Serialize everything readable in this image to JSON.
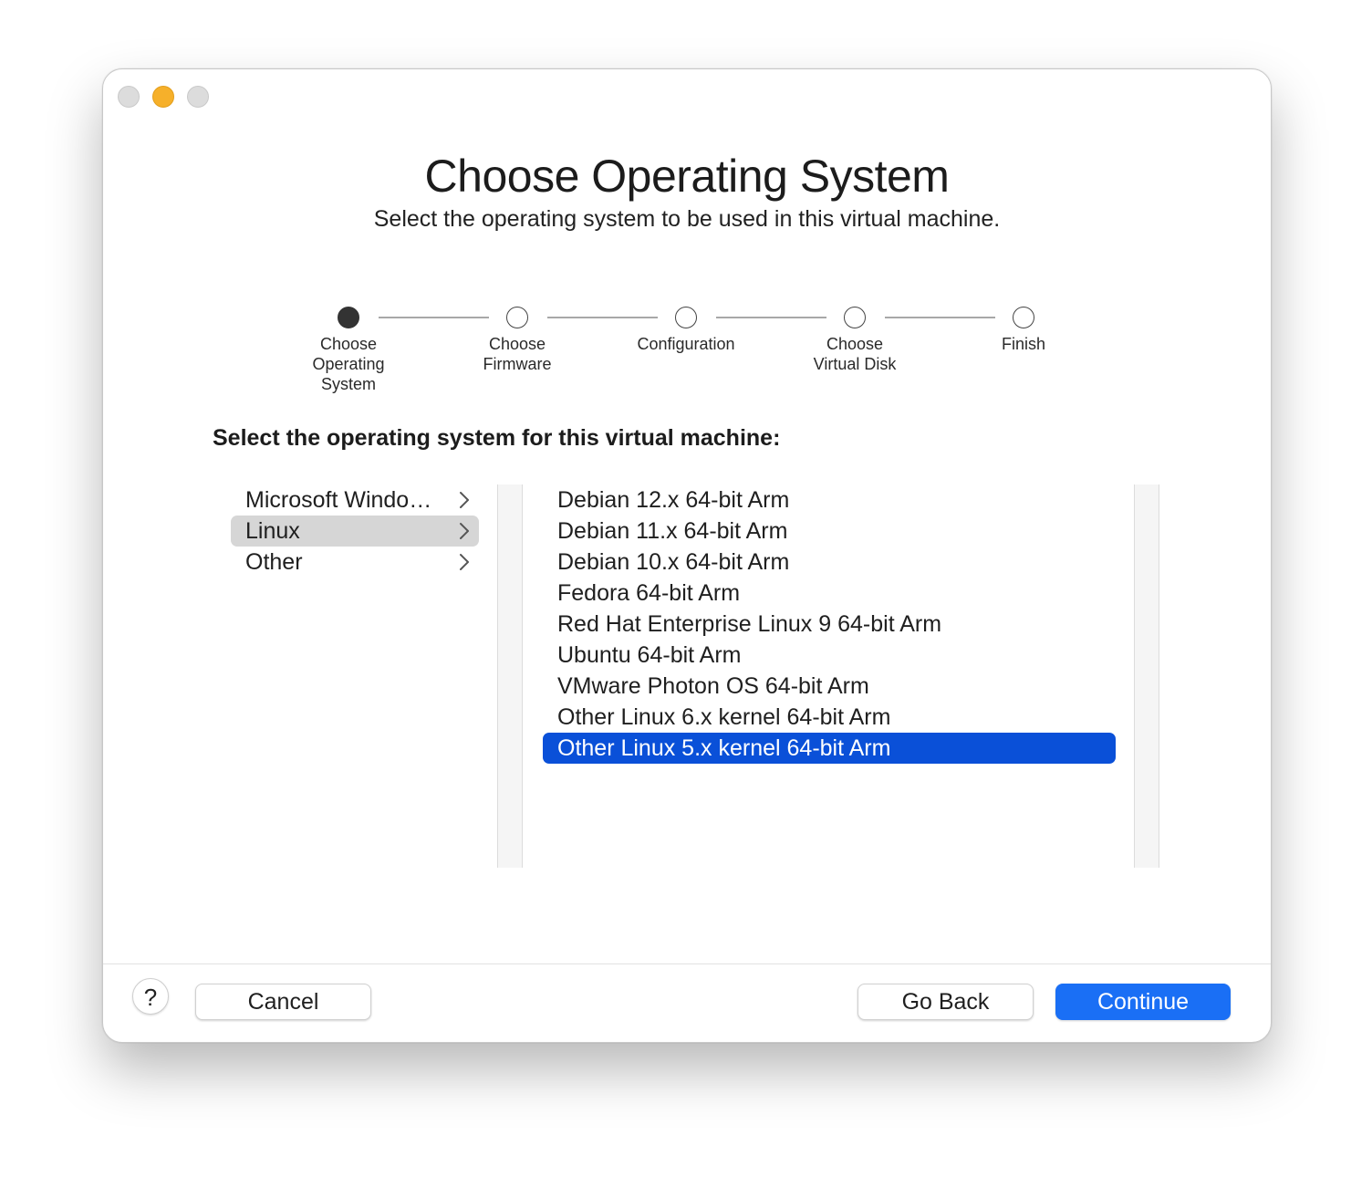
{
  "header": {
    "title": "Choose Operating System",
    "subtitle": "Select the operating system to be used in this virtual machine."
  },
  "steps": [
    {
      "label": "Choose\nOperating\nSystem",
      "active": true
    },
    {
      "label": "Choose\nFirmware",
      "active": false
    },
    {
      "label": "Configuration",
      "active": false
    },
    {
      "label": "Choose\nVirtual Disk",
      "active": false
    },
    {
      "label": "Finish",
      "active": false
    }
  ],
  "prompt": "Select the operating system for this virtual machine:",
  "categories": [
    {
      "label": "Microsoft Windo…",
      "selected": false
    },
    {
      "label": "Linux",
      "selected": true
    },
    {
      "label": "Other",
      "selected": false
    }
  ],
  "os_list": [
    {
      "label": "Debian 12.x 64-bit Arm",
      "selected": false
    },
    {
      "label": "Debian 11.x 64-bit Arm",
      "selected": false
    },
    {
      "label": "Debian 10.x 64-bit Arm",
      "selected": false
    },
    {
      "label": "Fedora 64-bit Arm",
      "selected": false
    },
    {
      "label": "Red Hat Enterprise Linux 9 64-bit Arm",
      "selected": false
    },
    {
      "label": "Ubuntu 64-bit Arm",
      "selected": false
    },
    {
      "label": "VMware Photon OS 64-bit Arm",
      "selected": false
    },
    {
      "label": "Other Linux 6.x kernel 64-bit Arm",
      "selected": false
    },
    {
      "label": "Other Linux 5.x kernel 64-bit Arm",
      "selected": true
    }
  ],
  "footer": {
    "help_label": "?",
    "cancel_label": "Cancel",
    "back_label": "Go Back",
    "continue_label": "Continue"
  },
  "colors": {
    "accent": "#1a6ff5",
    "selection": "#0a50d8",
    "minimize": "#f6b02a"
  }
}
